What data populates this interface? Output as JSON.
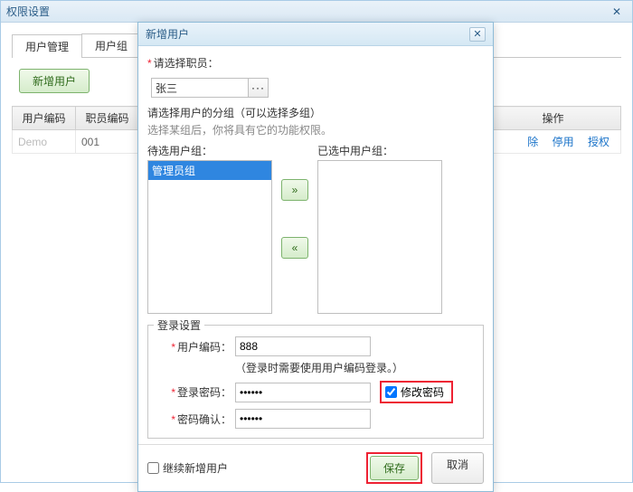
{
  "parent": {
    "title": "权限设置",
    "tabs": [
      "用户管理",
      "用户组"
    ],
    "add_user_btn": "新增用户",
    "table_headers": [
      "用户编码",
      "职员编码",
      "操作"
    ],
    "row": {
      "user_code": "Demo",
      "emp_code": "001"
    },
    "row_actions": {
      "delete": "除",
      "disable": "停用",
      "auth": "授权"
    }
  },
  "modal": {
    "title": "新增用户",
    "select_emp_label": "请选择职员：",
    "emp_value": "张三",
    "group_hint": "请选择用户的分组（可以选择多组）",
    "group_subhint": "选择某组后，你将具有它的功能权限。",
    "available_label": "待选用户组：",
    "selected_label": "已选中用户组：",
    "available_items": [
      "管理员组"
    ],
    "login_legend": "登录设置",
    "user_code_label": "用户编码：",
    "user_code_value": "888",
    "user_code_note": "（登录时需要使用用户编码登录。）",
    "password_label": "登录密码：",
    "password_value": "******",
    "modify_pwd_label": "修改密码",
    "confirm_label": "密码确认：",
    "confirm_value": "******",
    "continue_add_label": "继续新增用户",
    "save_btn": "保存",
    "cancel_btn": "取消"
  }
}
